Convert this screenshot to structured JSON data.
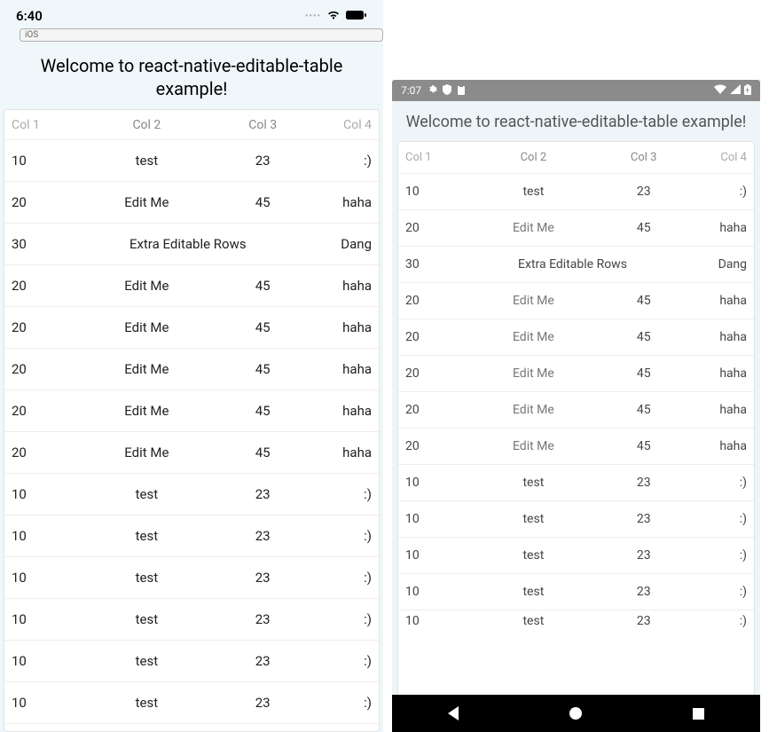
{
  "ios": {
    "status_time": "6:40",
    "badge": "iOS",
    "title": "Welcome to react-native-editable-table example!",
    "columns": [
      "Col 1",
      "Col 2",
      "Col 3",
      "Col 4"
    ],
    "rows": [
      {
        "c1": "10",
        "c2": "test",
        "c3": "23",
        "c4": ":)"
      },
      {
        "c1": "20",
        "c2": "Edit Me",
        "c3": "45",
        "c4": "haha"
      },
      {
        "c1": "30",
        "merged": "Extra Editable Rows",
        "c4": "Dang"
      },
      {
        "c1": "20",
        "c2": "Edit Me",
        "c3": "45",
        "c4": "haha"
      },
      {
        "c1": "20",
        "c2": "Edit Me",
        "c3": "45",
        "c4": "haha"
      },
      {
        "c1": "20",
        "c2": "Edit Me",
        "c3": "45",
        "c4": "haha"
      },
      {
        "c1": "20",
        "c2": "Edit Me",
        "c3": "45",
        "c4": "haha"
      },
      {
        "c1": "20",
        "c2": "Edit Me",
        "c3": "45",
        "c4": "haha"
      },
      {
        "c1": "10",
        "c2": "test",
        "c3": "23",
        "c4": ":)"
      },
      {
        "c1": "10",
        "c2": "test",
        "c3": "23",
        "c4": ":)"
      },
      {
        "c1": "10",
        "c2": "test",
        "c3": "23",
        "c4": ":)"
      },
      {
        "c1": "10",
        "c2": "test",
        "c3": "23",
        "c4": ":)"
      },
      {
        "c1": "10",
        "c2": "test",
        "c3": "23",
        "c4": ":)"
      },
      {
        "c1": "10",
        "c2": "test",
        "c3": "23",
        "c4": ":)"
      }
    ]
  },
  "android": {
    "status_time": "7:07",
    "title": "Welcome to react-native-editable-table example!",
    "columns": [
      "Col 1",
      "Col 2",
      "Col 3",
      "Col 4"
    ],
    "rows": [
      {
        "c1": "10",
        "c2": "test",
        "c3": "23",
        "c4": ":)"
      },
      {
        "c1": "20",
        "c2": "Edit Me",
        "c3": "45",
        "c4": "haha",
        "editable": true
      },
      {
        "c1": "30",
        "merged": "Extra Editable Rows",
        "c4": "Dang"
      },
      {
        "c1": "20",
        "c2": "Edit Me",
        "c3": "45",
        "c4": "haha",
        "editable": true
      },
      {
        "c1": "20",
        "c2": "Edit Me",
        "c3": "45",
        "c4": "haha",
        "editable": true
      },
      {
        "c1": "20",
        "c2": "Edit Me",
        "c3": "45",
        "c4": "haha",
        "editable": true
      },
      {
        "c1": "20",
        "c2": "Edit Me",
        "c3": "45",
        "c4": "haha",
        "editable": true
      },
      {
        "c1": "20",
        "c2": "Edit Me",
        "c3": "45",
        "c4": "haha",
        "editable": true
      },
      {
        "c1": "10",
        "c2": "test",
        "c3": "23",
        "c4": ":)"
      },
      {
        "c1": "10",
        "c2": "test",
        "c3": "23",
        "c4": ":)"
      },
      {
        "c1": "10",
        "c2": "test",
        "c3": "23",
        "c4": ":)"
      },
      {
        "c1": "10",
        "c2": "test",
        "c3": "23",
        "c4": ":)"
      },
      {
        "c1": "10",
        "c2": "test",
        "c3": "23",
        "c4": ":)",
        "cut": true
      }
    ]
  }
}
